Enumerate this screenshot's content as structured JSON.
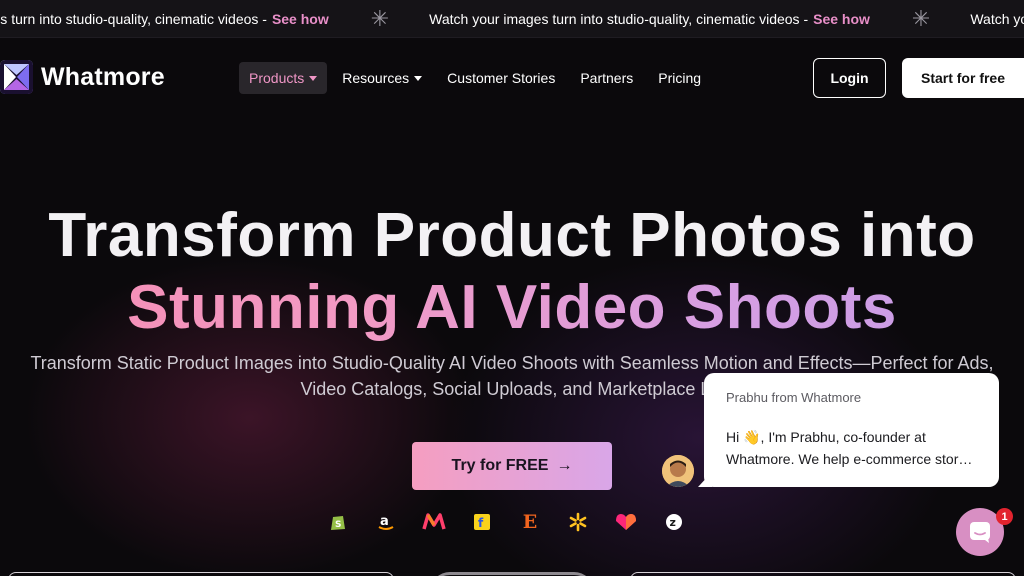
{
  "announcement": {
    "text": "Watch your images turn into studio-quality, cinematic videos -",
    "link": "See how",
    "partial_left_text": "ic videos -",
    "partial_right_text": "Watch your images turn into studio-c"
  },
  "brand": {
    "name": "Whatmore"
  },
  "nav": {
    "items": [
      {
        "label": "Products",
        "has_dropdown": true,
        "active": true
      },
      {
        "label": "Resources",
        "has_dropdown": true,
        "active": false
      },
      {
        "label": "Customer Stories",
        "has_dropdown": false,
        "active": false
      },
      {
        "label": "Partners",
        "has_dropdown": false,
        "active": false
      },
      {
        "label": "Pricing",
        "has_dropdown": false,
        "active": false
      }
    ],
    "login_label": "Login",
    "start_label": "Start for free"
  },
  "hero": {
    "title_line1": "Transform Product Photos into",
    "title_line2": "Stunning AI Video Shoots",
    "subtitle_line1": "Transform Static Product Images into Studio-Quality AI Video Shoots with Seamless Motion and Effects—Perfect for Ads,",
    "subtitle_line2": "Video Catalogs, Social Uploads, and Marketplace Lis",
    "cta_label": "Try for FREE",
    "cta_icon": "arrow-right-icon"
  },
  "platforms": [
    "shopify-icon",
    "amazon-icon",
    "myntra-icon",
    "flipkart-icon",
    "etsy-icon",
    "walmart-icon",
    "nykaa-icon",
    "zepto-icon"
  ],
  "chat": {
    "from": "Prabhu from Whatmore",
    "message": "Hi 👋, I'm Prabhu, co-founder at Whatmore. We help e-commerce stor…",
    "unread_count": "1"
  },
  "colors": {
    "accent_pink": "#e88fc8",
    "cta_gradient_start": "#f59ec0",
    "cta_gradient_end": "#d9a6e8",
    "background": "#0b090c"
  }
}
